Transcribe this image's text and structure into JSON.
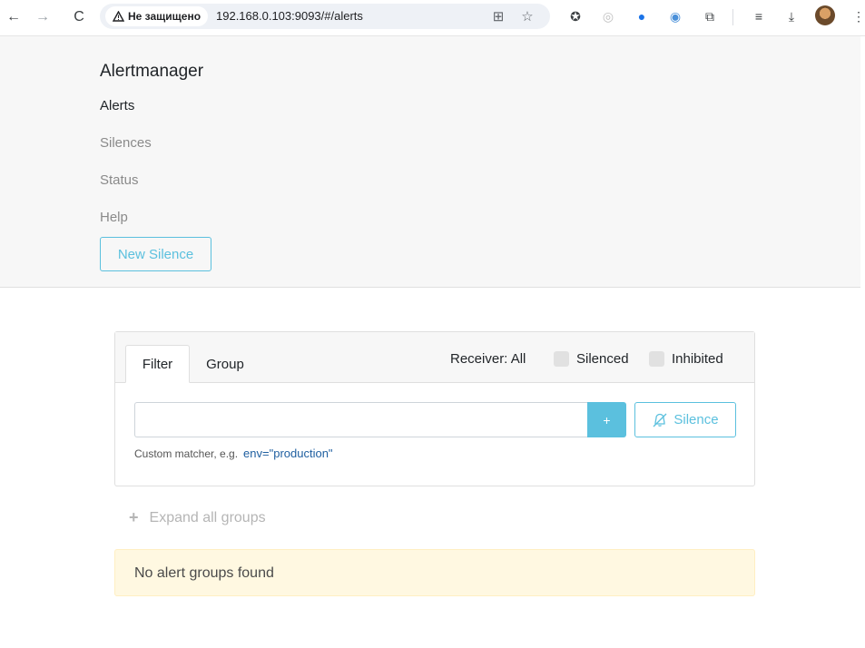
{
  "browser": {
    "security_label": "Не защищено",
    "url": "192.168.0.103:9093/#/alerts"
  },
  "navbar": {
    "brand": "Alertmanager",
    "links": [
      {
        "label": "Alerts",
        "active": true
      },
      {
        "label": "Silences",
        "active": false
      },
      {
        "label": "Status",
        "active": false
      },
      {
        "label": "Help",
        "active": false
      }
    ],
    "new_silence_label": "New Silence"
  },
  "filter_card": {
    "tabs": [
      {
        "label": "Filter",
        "active": true
      },
      {
        "label": "Group",
        "active": false
      }
    ],
    "receiver_label": "Receiver: All",
    "silenced_label": "Silenced",
    "inhibited_label": "Inhibited",
    "input_value": "",
    "plus_label": "+",
    "silence_button_label": "Silence",
    "hint_text": "Custom matcher, e.g.",
    "hint_example": "env=\"production\""
  },
  "expand_all_label": "Expand all groups",
  "empty_message": "No alert groups found",
  "colors": {
    "accent": "#5bc0de",
    "navbar_bg": "#f7f7f7",
    "alert_bg": "#fff8e1"
  }
}
